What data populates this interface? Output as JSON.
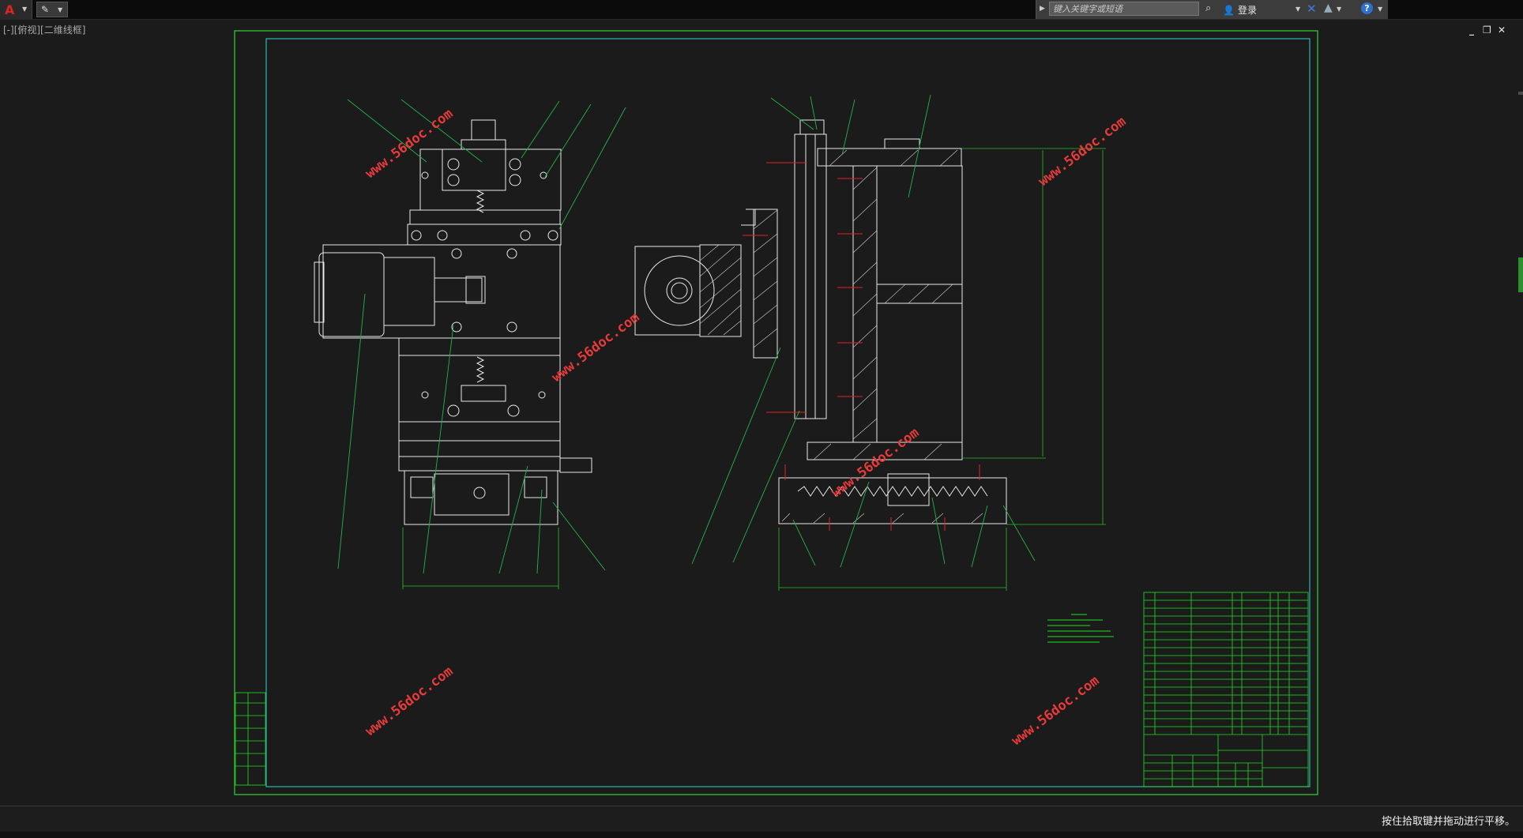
{
  "topbar": {
    "search": {
      "placeholder": "键入关键字或短语"
    },
    "login_label": "登录"
  },
  "viewport": {
    "label": "[-][俯视][二维线框]"
  },
  "watermark": {
    "text": "www.56doc.com"
  },
  "status": {
    "message": "按住拾取键并拖动进行平移。"
  },
  "colors": {
    "background": "#1b1b1b",
    "outer_border": "#2fae2f",
    "inner_border": "#2fb5b5",
    "part_lines": "#e8e8e8",
    "leader_lines": "#24b24a",
    "dimension_red": "#e02020",
    "watermark": "#e83a3a",
    "table_lines": "#22e022"
  },
  "icons": [
    "autocad-logo-icon",
    "quick-access-icon",
    "binoculars-icon",
    "user-icon",
    "exchange-x-icon",
    "autodesk-a-icon",
    "help-icon",
    "minimize-icon",
    "restore-icon",
    "close-icon"
  ]
}
